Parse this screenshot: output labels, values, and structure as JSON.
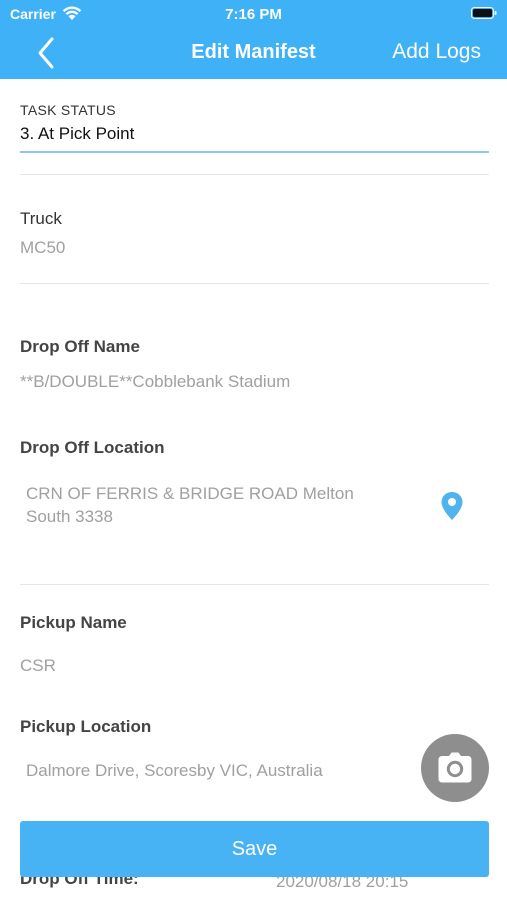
{
  "status_bar": {
    "carrier": "Carrier",
    "time": "7:16 PM"
  },
  "nav": {
    "title": "Edit Manifest",
    "right_action": "Add Logs",
    "back_icon": "chevron-left-icon"
  },
  "task_status": {
    "label": "TASK STATUS",
    "value": "3. At Pick Point"
  },
  "truck": {
    "label": "Truck",
    "value": "MC50"
  },
  "drop_off_name": {
    "label": "Drop Off Name",
    "value": "**B/DOUBLE**Cobblebank Stadium"
  },
  "drop_off_location": {
    "label": "Drop Off Location",
    "value_line1": "CRN OF FERRIS & BRIDGE ROAD Melton",
    "value_line2": "South 3338",
    "icon": "map-pin-icon"
  },
  "pickup_name": {
    "label": "Pickup Name",
    "value": "CSR"
  },
  "pickup_location": {
    "label": "Pickup Location",
    "value": "Dalmore Drive, Scoresby VIC, Australia"
  },
  "drop_off_time": {
    "label": "Drop Off Time:",
    "value": "2020/08/18 20:15"
  },
  "actions": {
    "save_label": "Save",
    "camera_icon": "camera-icon"
  },
  "colors": {
    "header": "#3fb1f6",
    "save_button": "#47b2f4",
    "pin": "#4fb3ef",
    "camera_fab": "#8e8e8e",
    "underline": "#8fc6ef"
  }
}
